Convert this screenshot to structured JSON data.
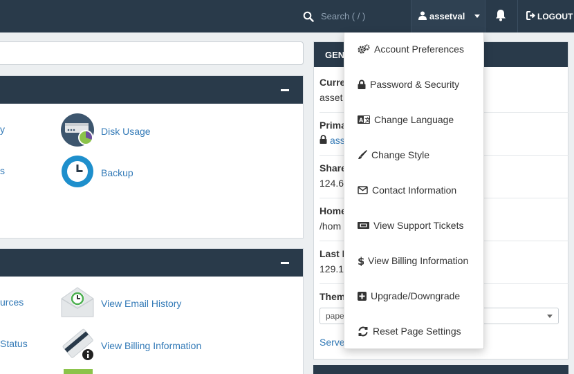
{
  "topbar": {
    "search_placeholder": "Search ( / )",
    "username": "assetval",
    "logout_label": "LOGOUT"
  },
  "left": {
    "panel1_items": [
      {
        "label": "Disk Usage",
        "icon": "disk-usage-icon"
      },
      {
        "label": "Backup",
        "icon": "backup-icon"
      }
    ],
    "panel1_truncated": [
      "y",
      "s"
    ],
    "panel2_items": [
      {
        "label": "View Email History",
        "icon": "email-history-icon"
      },
      {
        "label": "View Billing Information",
        "icon": "billing-card-icon"
      }
    ],
    "panel2_truncated": [
      "urces",
      "Status"
    ]
  },
  "right": {
    "header": "GEN",
    "stats": [
      {
        "label": "Curre",
        "value": "asset"
      },
      {
        "label": "Prima",
        "value": "ass"
      },
      {
        "label": "Share",
        "value": "124.6"
      },
      {
        "label": "Home",
        "value": "/hom"
      },
      {
        "label": "Last L",
        "value": "129.1"
      },
      {
        "label": "Them",
        "value": ""
      }
    ],
    "theme_value": "pape",
    "server_link": "Serve"
  },
  "dropdown": {
    "items": [
      {
        "label": "Account Preferences",
        "icon": "gears-icon"
      },
      {
        "label": "Password & Security",
        "icon": "lock-icon"
      },
      {
        "label": "Change Language",
        "icon": "language-icon"
      },
      {
        "label": "Change Style",
        "icon": "paintbrush-icon"
      },
      {
        "label": "Contact Information",
        "icon": "envelope-icon"
      },
      {
        "label": "View Support Tickets",
        "icon": "ticket-icon"
      },
      {
        "label": "View Billing Information",
        "icon": "dollar-icon"
      },
      {
        "label": "Upgrade/Downgrade",
        "icon": "plus-square-icon"
      },
      {
        "label": "Reset Page Settings",
        "icon": "refresh-icon"
      }
    ]
  },
  "colors": {
    "topbar": "#293a4a",
    "link": "#337ab7",
    "background": "#eceff1"
  }
}
